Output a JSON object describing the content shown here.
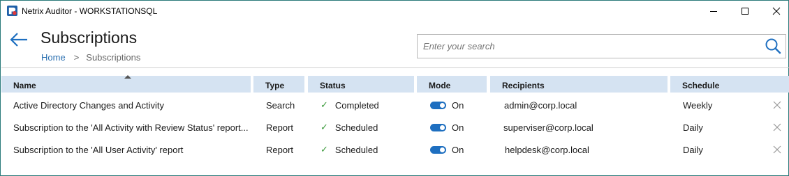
{
  "window": {
    "title": "Netrix Auditor - WORKSTATIONSQL"
  },
  "header": {
    "title": "Subscriptions",
    "breadcrumb": {
      "home": "Home",
      "separator": ">",
      "current": "Subscriptions"
    },
    "search": {
      "placeholder": "Enter your search",
      "value": ""
    }
  },
  "table": {
    "columns": [
      "Name",
      "Type",
      "Status",
      "Mode",
      "Recipients",
      "Schedule"
    ],
    "sorted_column": "Name",
    "rows": [
      {
        "name": "Active Directory Changes and Activity",
        "type": "Search",
        "status": "Completed",
        "mode": "On",
        "recipients": "admin@corp.local",
        "schedule": "Weekly"
      },
      {
        "name": "Subscription to the 'All Activity with Review Status' report...",
        "type": "Report",
        "status": "Scheduled",
        "mode": "On",
        "recipients": "superviser@corp.local",
        "schedule": "Daily"
      },
      {
        "name": "Subscription to the 'All User Activity' report",
        "type": "Report",
        "status": "Scheduled",
        "mode": "On",
        "recipients": "helpdesk@corp.local",
        "schedule": "Daily"
      }
    ]
  },
  "colors": {
    "accent": "#1e6fc0",
    "header_bg": "#d5e3f2",
    "status_check": "#3a9a3a",
    "link": "#2a6fb0"
  },
  "icons": {
    "app": "netwrix-logo-icon",
    "back": "back-arrow-icon",
    "search": "search-icon",
    "delete": "close-icon",
    "status": "check-icon"
  }
}
